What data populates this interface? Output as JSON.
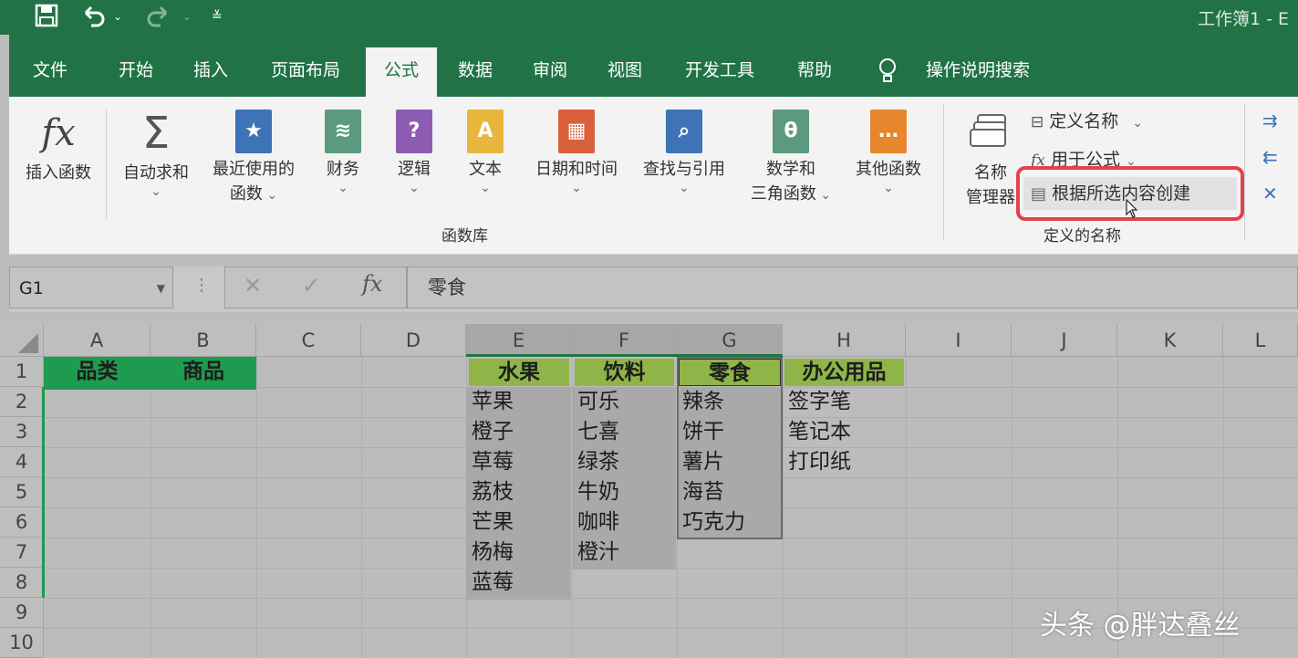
{
  "window": {
    "title": "工作簿1 - E"
  },
  "tabs": [
    "文件",
    "开始",
    "插入",
    "页面布局",
    "公式",
    "数据",
    "审阅",
    "视图",
    "开发工具",
    "帮助",
    "操作说明搜索"
  ],
  "ribbon": {
    "insert_function": "插入函数",
    "autosum": "自动求和",
    "recent_line1": "最近使用的",
    "recent_line2": "函数",
    "financial": "财务",
    "logical": "逻辑",
    "text": "文本",
    "datetime": "日期和时间",
    "lookup": "查找与引用",
    "math_line1": "数学和",
    "math_line2": "三角函数",
    "other": "其他函数",
    "function_library_label": "函数库",
    "name_manager_line1": "名称",
    "name_manager_line2": "管理器",
    "define_name": "定义名称",
    "use_in_formula": "用于公式",
    "create_from_selection": "根据所选内容创建",
    "defined_names_label": "定义的名称",
    "highlight_color": "#e0434f"
  },
  "formula_bar": {
    "name_box": "G1",
    "formula": "零食"
  },
  "sheet": {
    "columns": [
      "A",
      "B",
      "C",
      "D",
      "E",
      "F",
      "G",
      "H",
      "I",
      "J",
      "K",
      "L"
    ],
    "rows": [
      "1",
      "2",
      "3",
      "4",
      "5",
      "6",
      "7",
      "8",
      "9",
      "10"
    ],
    "A1": "品类",
    "B1": "商品",
    "E": [
      "水果",
      "苹果",
      "橙子",
      "草莓",
      "荔枝",
      "芒果",
      "杨梅",
      "蓝莓"
    ],
    "F": [
      "饮料",
      "可乐",
      "七喜",
      "绿茶",
      "牛奶",
      "咖啡",
      "橙汁"
    ],
    "G": [
      "零食",
      "辣条",
      "饼干",
      "薯片",
      "海苔",
      "巧克力"
    ],
    "H": [
      "办公用品",
      "签字笔",
      "笔记本",
      "打印纸"
    ],
    "header_green": "#1e9b4f",
    "category_green": "#8fb548"
  },
  "watermark": "头条 @胖达叠丝"
}
